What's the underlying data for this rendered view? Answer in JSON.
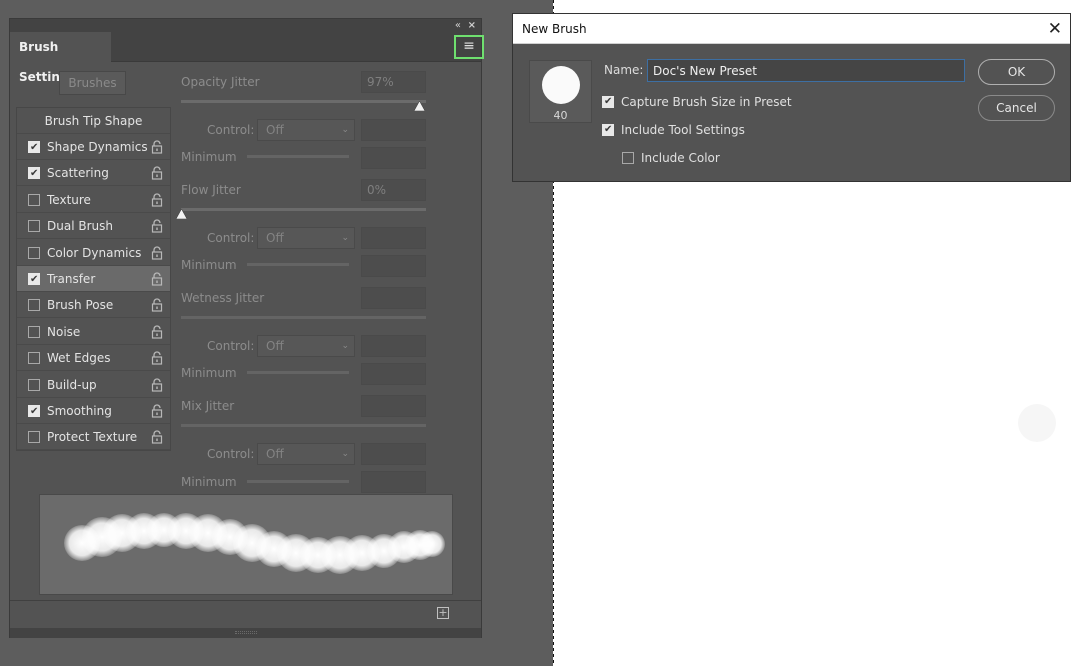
{
  "brush_settings": {
    "tab_label": "Brush Settings",
    "collapse_glyph": "«",
    "close_glyph": "×",
    "menu_glyph": "≡",
    "brushes_button": "Brushes",
    "tip_header": "Brush Tip Shape",
    "options": [
      {
        "label": "Shape Dynamics",
        "checked": true
      },
      {
        "label": "Scattering",
        "checked": true
      },
      {
        "label": "Texture",
        "checked": false
      },
      {
        "label": "Dual Brush",
        "checked": false
      },
      {
        "label": "Color Dynamics",
        "checked": false
      },
      {
        "label": "Transfer",
        "checked": true,
        "selected": true
      },
      {
        "label": "Brush Pose",
        "checked": false
      },
      {
        "label": "Noise",
        "checked": false
      },
      {
        "label": "Wet Edges",
        "checked": false
      },
      {
        "label": "Build-up",
        "checked": false
      },
      {
        "label": "Smoothing",
        "checked": true
      },
      {
        "label": "Protect Texture",
        "checked": false
      }
    ],
    "transfer": {
      "opacity_jitter": {
        "label": "Opacity Jitter",
        "value": "97%",
        "fraction": 0.97
      },
      "control_label": "Control:",
      "control_value": "Off",
      "minimum_label": "Minimum",
      "flow_jitter": {
        "label": "Flow Jitter",
        "value": "0%",
        "fraction": 0.0
      },
      "wetness_jitter": {
        "label": "Wetness Jitter",
        "value": ""
      },
      "mix_jitter": {
        "label": "Mix Jitter",
        "value": ""
      }
    },
    "footer_new_glyph": "+"
  },
  "new_brush_dialog": {
    "title": "New Brush",
    "close_glyph": "✕",
    "brush_size": "40",
    "name_label": "Name:",
    "name_value": "Doc's New Preset",
    "capture_size": {
      "label": "Capture Brush Size in Preset",
      "checked": true
    },
    "include_tool": {
      "label": "Include Tool Settings",
      "checked": true
    },
    "include_color": {
      "label": "Include Color",
      "checked": false
    },
    "ok_label": "OK",
    "cancel_label": "Cancel"
  },
  "colors": {
    "panel": "#535353",
    "canvas": "#ffffff",
    "highlight": "#6fe06f",
    "focus": "#3d6fa3"
  }
}
